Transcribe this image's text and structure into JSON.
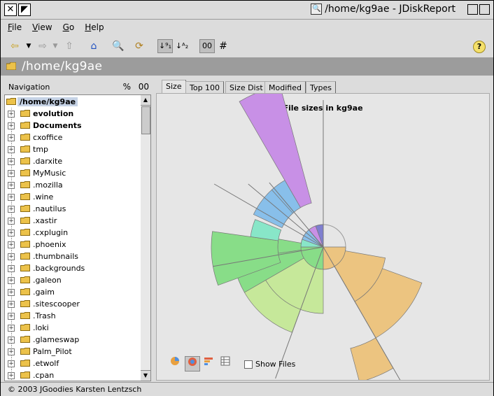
{
  "window": {
    "title": "/home/kg9ae - JDiskReport"
  },
  "menu": [
    "File",
    "View",
    "Go",
    "Help"
  ],
  "toolbar": {
    "sort_size_label": "↓⁹₁",
    "sort_name_label": "↓ᴬ₂",
    "zz_label": "00",
    "hash_label": "#",
    "help_label": "?"
  },
  "path": "/home/kg9ae",
  "navigation": {
    "title": "Navigation",
    "percent_label": "%",
    "zz_label": "00",
    "root": "/home/kg9ae",
    "items": [
      {
        "label": "evolution",
        "bold": true
      },
      {
        "label": "Documents",
        "bold": true
      },
      {
        "label": "cxoffice",
        "bold": false
      },
      {
        "label": "tmp",
        "bold": false
      },
      {
        "label": ".darxite",
        "bold": false
      },
      {
        "label": "MyMusic",
        "bold": false
      },
      {
        "label": ".mozilla",
        "bold": false
      },
      {
        "label": ".wine",
        "bold": false
      },
      {
        "label": ".nautilus",
        "bold": false
      },
      {
        "label": ".xastir",
        "bold": false
      },
      {
        "label": ".cxplugin",
        "bold": false
      },
      {
        "label": ".phoenix",
        "bold": false
      },
      {
        "label": ".thumbnails",
        "bold": false
      },
      {
        "label": ".backgrounds",
        "bold": false
      },
      {
        "label": ".galeon",
        "bold": false
      },
      {
        "label": ".gaim",
        "bold": false
      },
      {
        "label": ".sitescooper",
        "bold": false
      },
      {
        "label": ".Trash",
        "bold": false
      },
      {
        "label": ".loki",
        "bold": false
      },
      {
        "label": ".glameswap",
        "bold": false
      },
      {
        "label": "Palm_Pilot",
        "bold": false
      },
      {
        "label": ".etwolf",
        "bold": false
      },
      {
        "label": ".cpan",
        "bold": false
      }
    ]
  },
  "tabs": [
    "Size",
    "Top 100",
    "Size Dist",
    "Modified",
    "Types"
  ],
  "chart": {
    "title": "File sizes in kg9ae",
    "show_files_label": "Show Files"
  },
  "colors": {
    "green": "#88dd88",
    "light_green": "#c6e89a",
    "orange": "#ecc480",
    "purple": "#c890e6",
    "blue": "#88bfea",
    "teal": "#88e6c8",
    "navy": "#7f7fd0"
  },
  "status": "© 2003 JGoodies Karsten Lentzsch"
}
